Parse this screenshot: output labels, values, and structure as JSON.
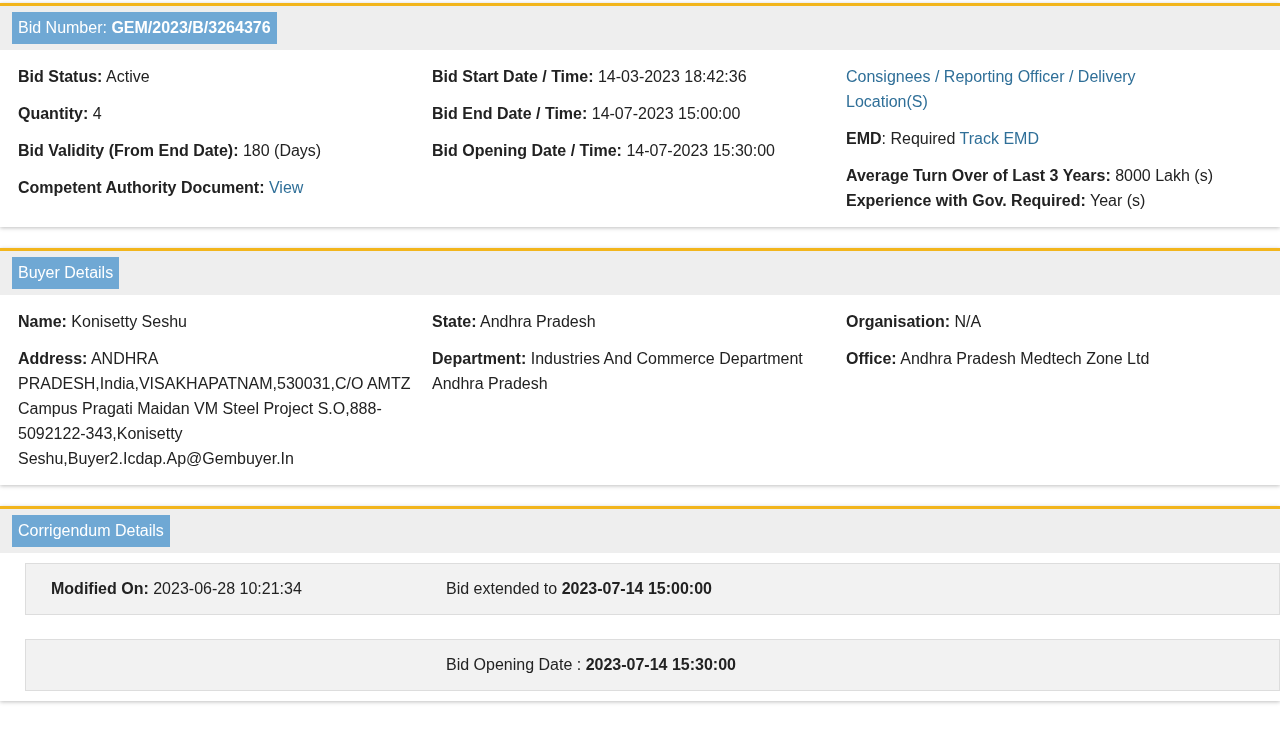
{
  "bid_card": {
    "header": "Bid Number: **GEM/2023/B/3264376**",
    "columns": [
      [
        {
          "lines": [
            {
              "text": "**Bid Status:** Active"
            }
          ]
        },
        {
          "lines": [
            {
              "text": "**Quantity:** 4"
            }
          ]
        },
        {
          "lines": [
            {
              "text": "**Bid Validity (From End Date):** 180 (Days)"
            }
          ]
        },
        {
          "lines": [
            {
              "text": "**Competent Authority Document:** ",
              "link": "View"
            }
          ]
        }
      ],
      [
        {
          "lines": [
            {
              "text": "**Bid Start Date / Time:** 14-03-2023 18:42:36"
            }
          ]
        },
        {
          "lines": [
            {
              "text": "**Bid End Date / Time:** 14-07-2023 15:00:00"
            }
          ]
        },
        {
          "lines": [
            {
              "text": "**Bid Opening Date / Time:** 14-07-2023 15:30:00"
            }
          ]
        }
      ],
      [
        {
          "lines": [
            {
              "link": "Consignees / Reporting Officer / Delivery Location(S)"
            }
          ]
        },
        {
          "lines": [
            {
              "text": "**EMD**: Required ",
              "link": "Track EMD"
            }
          ]
        },
        {
          "lines": [
            {
              "text": "**Average Turn Over of Last 3 Years:** 8000 Lakh (s)"
            },
            {
              "text": "**Experience with Gov. Required:** Year (s)"
            }
          ]
        }
      ]
    ]
  },
  "buyer_card": {
    "header": "Buyer Details",
    "columns": [
      [
        {
          "lines": [
            {
              "text": "**Name:** Konisetty Seshu"
            }
          ]
        },
        {
          "lines": [
            {
              "text": "**Address:** ANDHRA PRADESH,India,VISAKHAPATNAM,530031,C/O AMTZ Campus Pragati Maidan VM Steel Project S.O,888-5092122-343,Konisetty Seshu,Buyer2.Icdap.Ap@Gembuyer.In"
            }
          ]
        }
      ],
      [
        {
          "lines": [
            {
              "text": "**State:** Andhra Pradesh"
            }
          ]
        },
        {
          "lines": [
            {
              "text": "**Department:** Industries And Commerce Department Andhra Pradesh"
            }
          ]
        }
      ],
      [
        {
          "lines": [
            {
              "text": "**Organisation:** N/A"
            }
          ]
        },
        {
          "lines": [
            {
              "text": "**Office:** Andhra Pradesh Medtech Zone Ltd"
            }
          ]
        }
      ]
    ]
  },
  "corrigendum_card": {
    "header": "Corrigendum Details",
    "rows": [
      {
        "modified": "**Modified On:** 2023-06-28 10:21:34",
        "change": "Bid extended to **2023-07-14 15:00:00**"
      },
      {
        "change": "Bid Opening Date : **2023-07-14 15:30:00**"
      }
    ]
  }
}
